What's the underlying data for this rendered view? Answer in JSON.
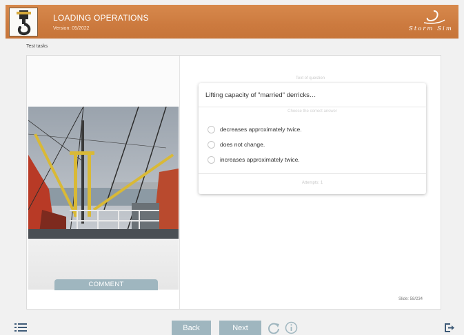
{
  "header": {
    "title": "LOADING OPERATIONS",
    "version": "Version: 05/2022",
    "brand": "Storm Sim",
    "logo_icon": "crane-hook-icon",
    "accent_color": "#cc7a3f"
  },
  "breadcrumb": "Test tasks",
  "question": {
    "caption": "Text of question",
    "text": "Lifting capacity of \"married\" derricks…",
    "choose_label": "Choose the correct answer",
    "options": [
      {
        "label": "decreases approximately twice."
      },
      {
        "label": "does not change."
      },
      {
        "label": "increases approximately twice."
      }
    ],
    "attempts": "Attempts: 1"
  },
  "comment_button": "COMMENT",
  "slide_counter": "Slide: 58/234",
  "nav": {
    "back": "Back",
    "next": "Next",
    "menu_icon": "menu-list-icon",
    "reload_icon": "reload-icon",
    "info_icon": "info-icon",
    "exit_icon": "exit-icon",
    "button_color": "#9fb6bf"
  }
}
